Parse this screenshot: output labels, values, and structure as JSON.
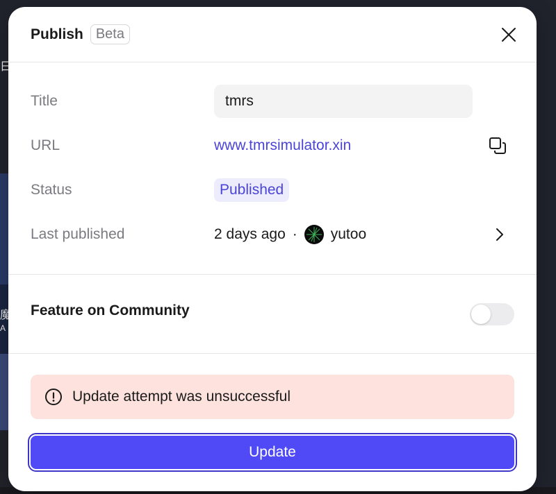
{
  "header": {
    "title": "Publish",
    "badge": "Beta"
  },
  "details": {
    "title_label": "Title",
    "title_value": "tmrs",
    "url_label": "URL",
    "url_value": "www.tmrsimulator.xin",
    "status_label": "Status",
    "status_value": "Published",
    "last_published_label": "Last published",
    "last_published_time": "2 days ago",
    "separator": "·",
    "publisher": "yutoo"
  },
  "feature": {
    "label": "Feature on Community",
    "enabled": false
  },
  "error": {
    "message": "Update attempt was unsuccessful"
  },
  "actions": {
    "update_label": "Update"
  },
  "backdrop": {
    "glyph_1": "日",
    "glyph_2": "魔",
    "glyph_3": "A"
  },
  "colors": {
    "accent": "#4f4af5",
    "link": "#4b44d6",
    "status_bg": "#ececfd",
    "error_bg": "#fde2dd"
  },
  "icons": {
    "close": "close-icon",
    "copy": "copy-icon",
    "chevron": "chevron-right-icon",
    "alert": "alert-circle-icon"
  }
}
